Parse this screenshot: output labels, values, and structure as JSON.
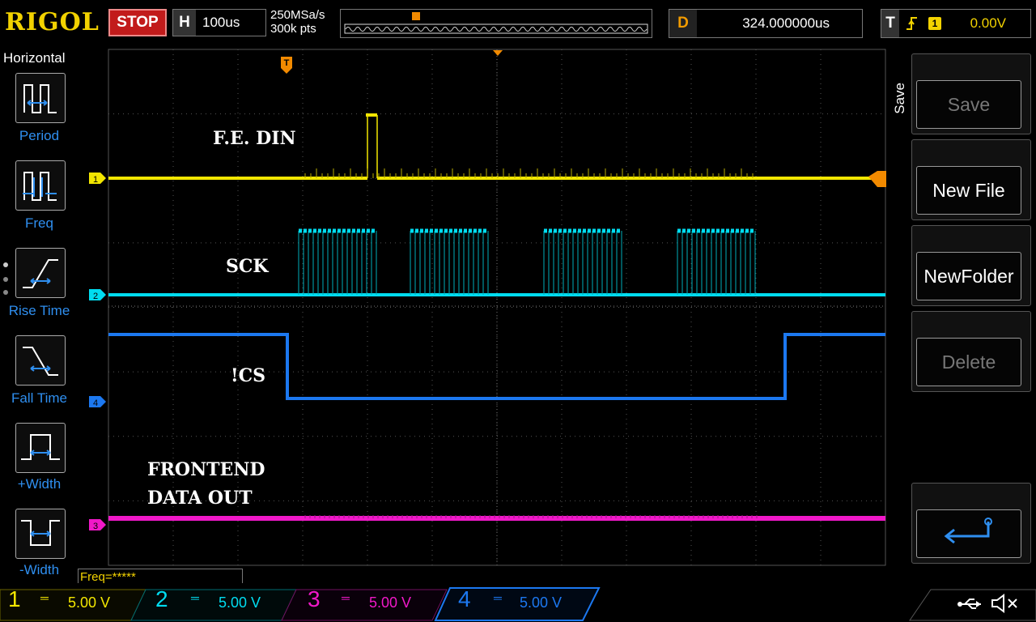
{
  "header": {
    "logo": "RIGOL",
    "run_state": "STOP",
    "timebase_label": "H",
    "timebase_value": "100us",
    "sample_rate": "250MSa/s",
    "memory_depth": "300k pts",
    "delay_label": "D",
    "delay_value": "324.000000us",
    "trigger_label": "T",
    "trigger_edge_icon": "rising-edge-icon",
    "trigger_channel": "1",
    "trigger_level": "0.00V"
  },
  "left_menu": {
    "title": "Horizontal",
    "items": [
      {
        "label": "Period",
        "icon": "period-icon"
      },
      {
        "label": "Freq",
        "icon": "frequency-icon"
      },
      {
        "label": "Rise Time",
        "icon": "rise-time-icon"
      },
      {
        "label": "Fall Time",
        "icon": "fall-time-icon"
      },
      {
        "label": "+Width",
        "icon": "positive-width-icon"
      },
      {
        "label": "-Width",
        "icon": "negative-width-icon"
      }
    ]
  },
  "right_menu": {
    "tab": "Save",
    "buttons": [
      {
        "label": "Save",
        "enabled": false
      },
      {
        "label": "New File",
        "enabled": true
      },
      {
        "label": "NewFolder",
        "enabled": true
      },
      {
        "label": "Delete",
        "enabled": false
      },
      {
        "label": "",
        "icon": "return-arrow-icon",
        "enabled": true
      }
    ]
  },
  "annotations": {
    "ch1": "F.E. DIN",
    "ch2": "SCK",
    "ch4": "!CS",
    "ch3_line1": "FRONTEND",
    "ch3_line2": "DATA OUT"
  },
  "markers": {
    "trigger_marker": "T",
    "ch1": "1",
    "ch2": "2",
    "ch3": "3",
    "ch4": "4"
  },
  "freq_readout": "Freq=*****",
  "channels": [
    {
      "num": "1",
      "scale": "5.00 V",
      "color": "#f2e600"
    },
    {
      "num": "2",
      "scale": "5.00 V",
      "color": "#00dcf0"
    },
    {
      "num": "3",
      "scale": "5.00 V",
      "color": "#f018c8"
    },
    {
      "num": "4",
      "scale": "5.00 V",
      "color": "#1c78f0"
    }
  ],
  "status_icons": [
    "usb-icon",
    "speaker-mute-icon"
  ],
  "colors": {
    "ch1": "#f2e600",
    "ch2": "#00dcf0",
    "ch3": "#f018c8",
    "ch4": "#1c78f0",
    "trigger": "#f28a00",
    "logo": "#f2d200",
    "stop": "#c21b1b"
  }
}
